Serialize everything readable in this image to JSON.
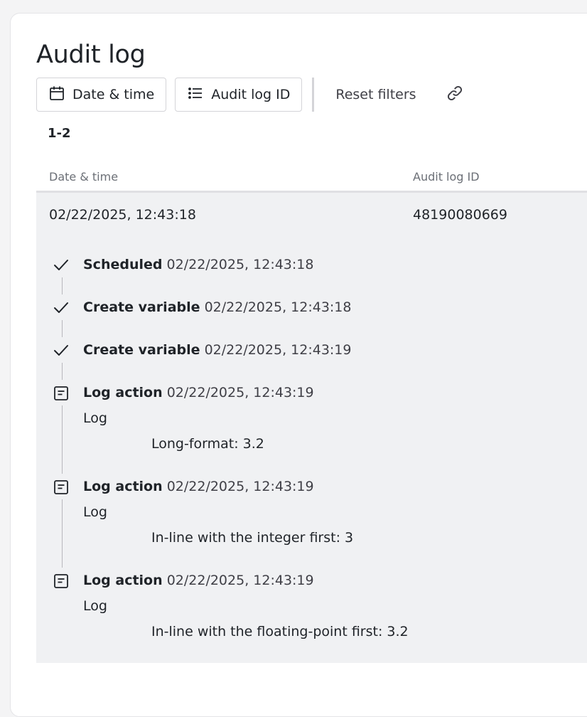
{
  "page": {
    "title": "Audit log"
  },
  "toolbar": {
    "date_filter_label": "Date & time",
    "id_filter_label": "Audit log ID",
    "reset_label": "Reset filters",
    "date_filter_icon": "calendar-icon",
    "id_filter_icon": "list-icon",
    "share_icon": "link-icon"
  },
  "results": {
    "range": "1-2"
  },
  "table": {
    "columns": [
      "Date & time",
      "Audit log ID"
    ],
    "rows": [
      {
        "date_time": "02/22/2025, 12:43:18",
        "audit_log_id": "48190080669",
        "events": [
          {
            "icon": "check-icon",
            "name": "Scheduled",
            "time": "02/22/2025, 12:43:18"
          },
          {
            "icon": "check-icon",
            "name": "Create variable",
            "time": "02/22/2025, 12:43:18"
          },
          {
            "icon": "check-icon",
            "name": "Create variable",
            "time": "02/22/2025, 12:43:19"
          },
          {
            "icon": "log-icon",
            "name": "Log action",
            "time": "02/22/2025, 12:43:19",
            "log_title": "Log",
            "log_detail": "Long-format: 3.2"
          },
          {
            "icon": "log-icon",
            "name": "Log action",
            "time": "02/22/2025, 12:43:19",
            "log_title": "Log",
            "log_detail": "In-line with the integer first: 3"
          },
          {
            "icon": "log-icon",
            "name": "Log action",
            "time": "02/22/2025, 12:43:19",
            "log_title": "Log",
            "log_detail": "In-line with the floating-point first: 3.2"
          }
        ]
      }
    ]
  },
  "colors": {
    "row_background": "#f0f1f3",
    "border": "#d4d4d8",
    "muted_text": "#6b6f76"
  }
}
